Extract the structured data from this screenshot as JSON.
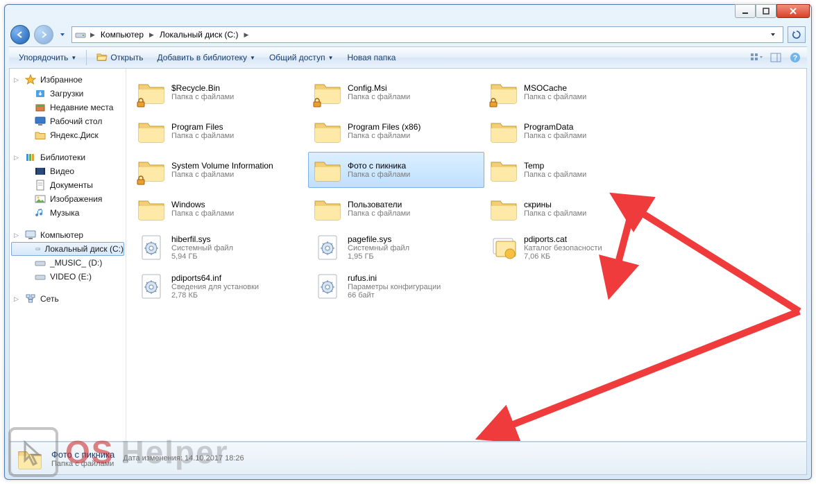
{
  "breadcrumbs": {
    "root": "Компьютер",
    "drive": "Локальный диск (C:)"
  },
  "toolbar": {
    "organize": "Упорядочить",
    "open": "Открыть",
    "add_to_library": "Добавить в библиотеку",
    "share": "Общий доступ",
    "new_folder": "Новая папка"
  },
  "sidebar": {
    "favorites": {
      "header": "Избранное",
      "items": [
        "Загрузки",
        "Недавние места",
        "Рабочий стол",
        "Яндекс.Диск"
      ]
    },
    "libraries": {
      "header": "Библиотеки",
      "items": [
        "Видео",
        "Документы",
        "Изображения",
        "Музыка"
      ]
    },
    "computer": {
      "header": "Компьютер",
      "items": [
        "Локальный диск (C:)",
        "_MUSIC_ (D:)",
        "VIDEO (E:)"
      ]
    },
    "network": {
      "header": "Сеть"
    }
  },
  "labels": {
    "folder_desc": "Папка с файлами"
  },
  "items": [
    {
      "name": "$Recycle.Bin",
      "type": "folder",
      "locked": true,
      "desc": "Папка с файлами"
    },
    {
      "name": "Config.Msi",
      "type": "folder",
      "locked": true,
      "desc": "Папка с файлами"
    },
    {
      "name": "MSOCache",
      "type": "folder",
      "locked": true,
      "desc": "Папка с файлами"
    },
    {
      "name": "Program Files",
      "type": "folder",
      "desc": "Папка с файлами"
    },
    {
      "name": "Program Files (x86)",
      "type": "folder",
      "desc": "Папка с файлами"
    },
    {
      "name": "ProgramData",
      "type": "folder",
      "desc": "Папка с файлами"
    },
    {
      "name": "System Volume Information",
      "type": "folder",
      "locked": true,
      "desc": "Папка с файлами"
    },
    {
      "name": "Фото с пикника",
      "type": "folder",
      "selected": true,
      "desc": "Папка с файлами"
    },
    {
      "name": "Temp",
      "type": "folder",
      "desc": "Папка с файлами"
    },
    {
      "name": "Windows",
      "type": "folder",
      "desc": "Папка с файлами"
    },
    {
      "name": "Пользователи",
      "type": "folder",
      "desc": "Папка с файлами"
    },
    {
      "name": "скрины",
      "type": "folder",
      "desc": "Папка с файлами"
    },
    {
      "name": "hiberfil.sys",
      "type": "sys",
      "desc": "Системный файл",
      "size": "5,94 ГБ"
    },
    {
      "name": "pagefile.sys",
      "type": "sys",
      "desc": "Системный файл",
      "size": "1,95 ГБ"
    },
    {
      "name": "pdiports.cat",
      "type": "cat",
      "desc": "Каталог безопасности",
      "size": "7,06 КБ"
    },
    {
      "name": "pdiports64.inf",
      "type": "inf",
      "desc": "Сведения для установки",
      "size": "2,78 КБ"
    },
    {
      "name": "rufus.ini",
      "type": "ini",
      "desc": "Параметры конфигурации",
      "size": "66 байт"
    }
  ],
  "status": {
    "name": "Фото с пикника",
    "type": "Папка с файлами",
    "modified_label": "Дата изменения:",
    "modified": "14.10.2017 18:26"
  },
  "watermark": {
    "text1": "OS",
    "text2": "Helper"
  }
}
